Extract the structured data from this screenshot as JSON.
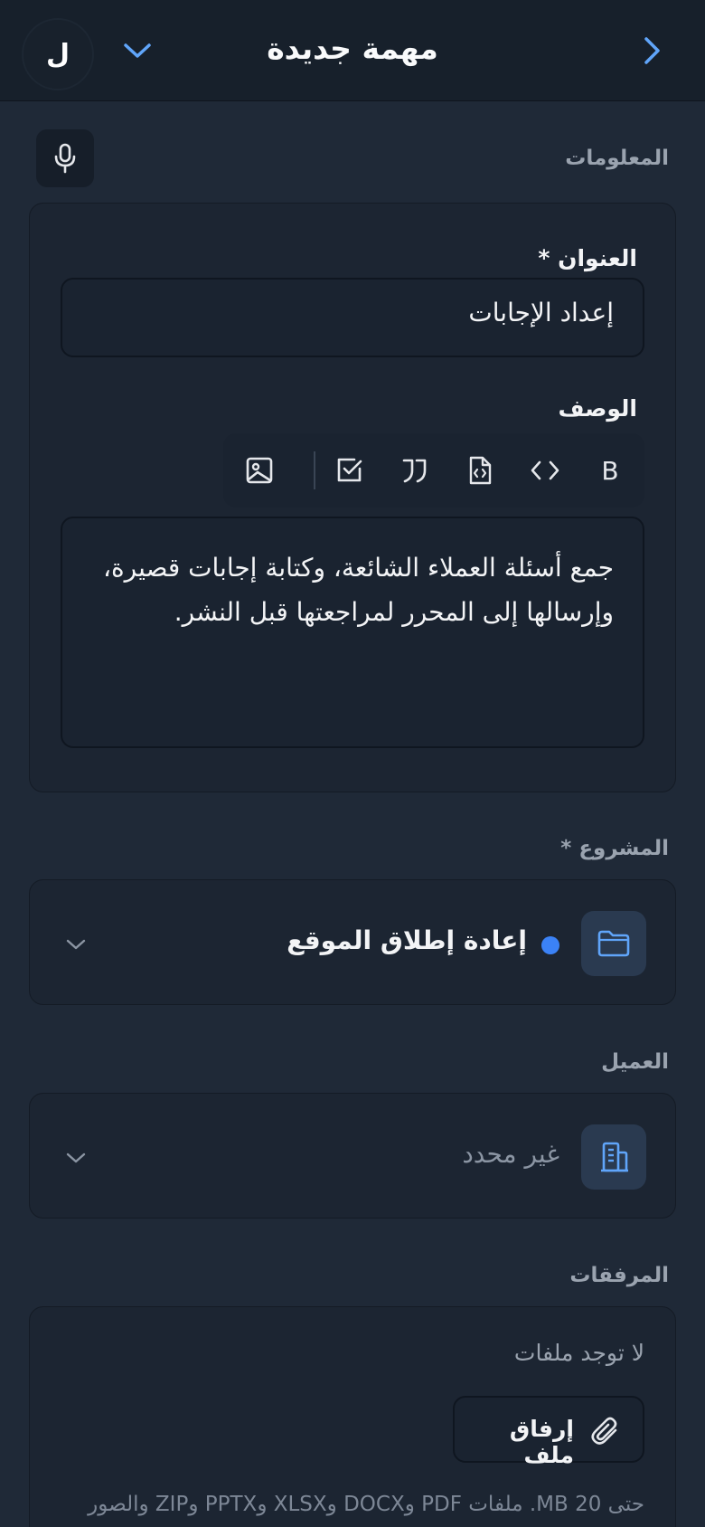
{
  "header": {
    "title": "مهمة جديدة",
    "avatar_initial": "ل",
    "icons": {
      "back": "chevron-right-icon",
      "dropdown": "chevron-down-icon"
    }
  },
  "info_section": {
    "label": "المعلومات",
    "mic_icon": "microphone-icon",
    "title_field": {
      "label": "العنوان *",
      "value": "إعداد الإجابات"
    },
    "description_field": {
      "label": "الوصف",
      "value": "جمع أسئلة العملاء الشائعة، وكتابة إجابات قصيرة، وإرسالها إلى المحرر لمراجعتها قبل النشر.",
      "toolbar": [
        {
          "name": "bold",
          "icon": "bold-icon",
          "glyph": "B"
        },
        {
          "name": "code",
          "icon": "code-icon"
        },
        {
          "name": "code-block",
          "icon": "code-file-icon"
        },
        {
          "name": "quote",
          "icon": "quote-icon"
        },
        {
          "name": "checklist",
          "icon": "checkbox-icon"
        },
        {
          "name": "image",
          "icon": "image-icon"
        }
      ]
    }
  },
  "project_section": {
    "label": "المشروع *",
    "selected": "إعادة إطلاق الموقع",
    "dot_color": "#3b82f6",
    "icon": "folder-icon"
  },
  "client_section": {
    "label": "العميل",
    "selected": "غير محدد",
    "icon": "building-icon"
  },
  "attachments_section": {
    "label": "المرفقات",
    "empty_text": "لا توجد ملفات",
    "attach_button": "إرفاق ملف",
    "help_text": "حتى 20 MB. ملفات PDF وDOCX وXLSX وPPTX وZIP والصور"
  },
  "colors": {
    "background": "#1f2937",
    "header": "#17202b",
    "card": "#1c2532",
    "accent": "#60a5fa"
  }
}
